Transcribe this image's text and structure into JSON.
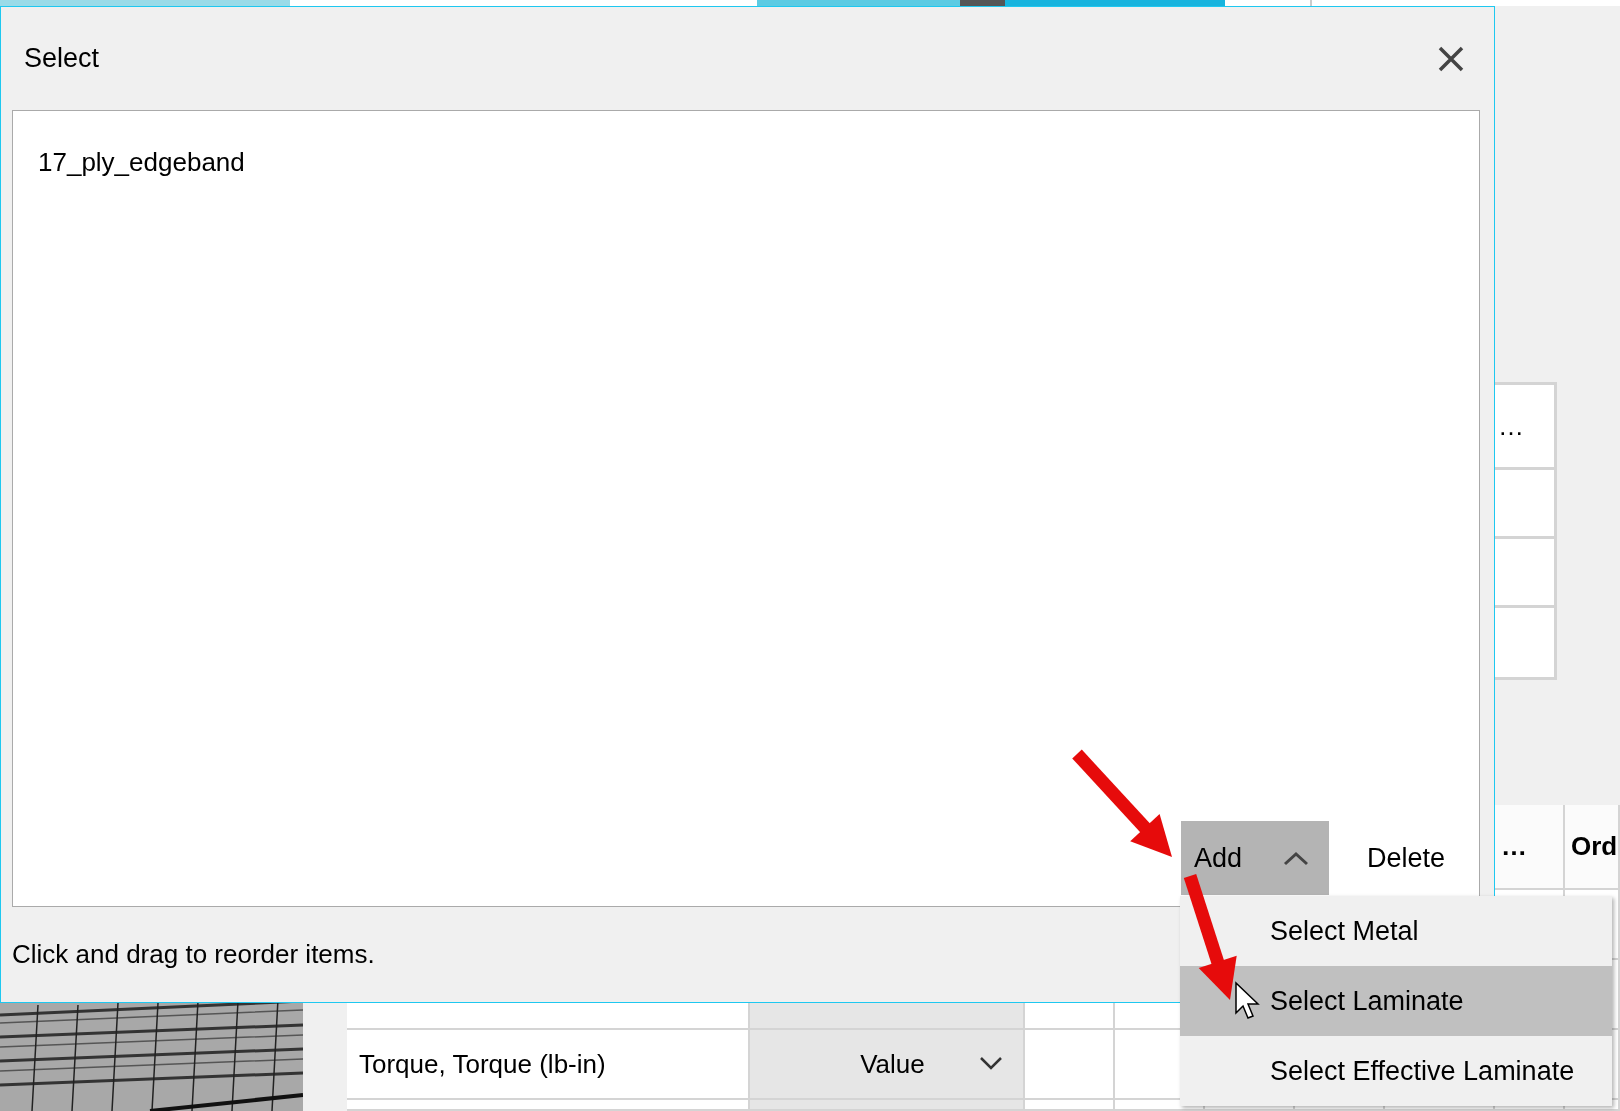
{
  "background": {
    "side_table": {
      "header": "…"
    },
    "main_table": {
      "headers": [
        {
          "text": "…"
        },
        {
          "text": "Ord"
        }
      ],
      "rows": [
        {
          "label": "",
          "type": ""
        },
        {
          "label": "Torque, Torque (lb-in)",
          "type": "Value"
        }
      ]
    }
  },
  "dialog": {
    "title": "Select",
    "items": [
      "17_ply_edgeband"
    ],
    "add_button": {
      "label": "Add",
      "expanded": true
    },
    "delete_button": {
      "label": "Delete"
    },
    "add_menu": {
      "items": [
        {
          "label": "Select Metal",
          "selected": false
        },
        {
          "label": "Select Laminate",
          "selected": true
        },
        {
          "label": "Select Effective Laminate",
          "selected": false
        }
      ]
    },
    "hint": "Click and drag to reorder items."
  }
}
